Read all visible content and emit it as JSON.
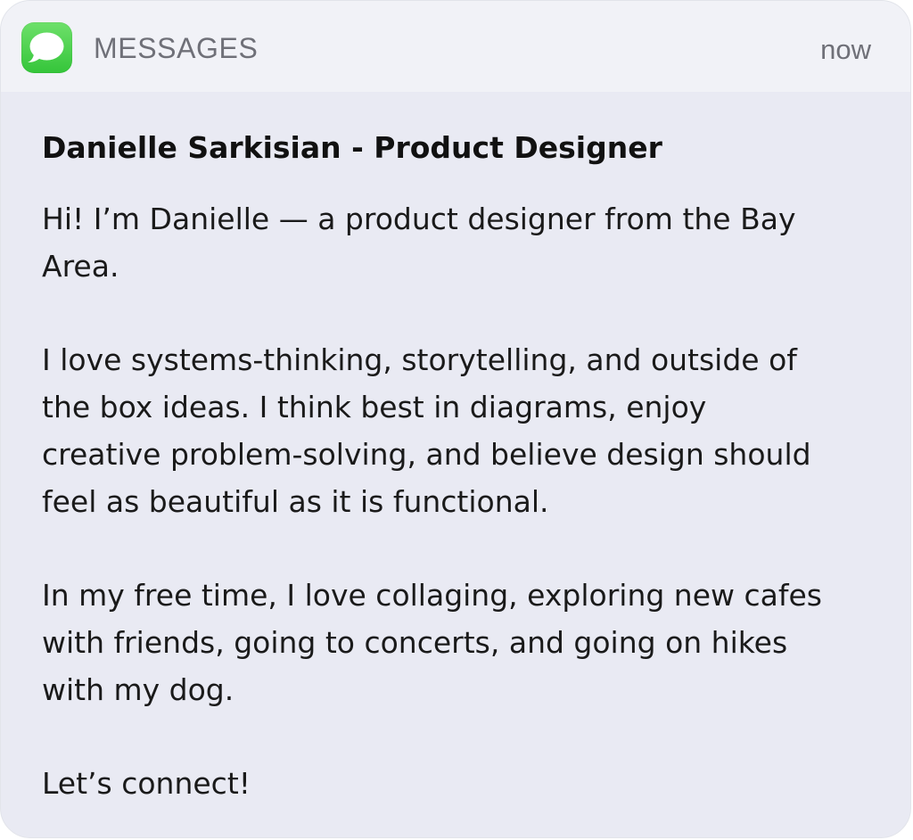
{
  "notification": {
    "app": {
      "name": "MESSAGES",
      "icon": "messages-bubble-icon",
      "icon_color": "#4cd15a"
    },
    "timestamp": "now",
    "sender": "Danielle Sarkisian - Product Designer",
    "body": {
      "paragraphs": [
        "Hi! I’m Danielle — a product designer from the Bay\nArea.",
        "I love systems-thinking, storytelling, and outside of\nthe box ideas. I think best in diagrams, enjoy\ncreative problem-solving, and believe design should\nfeel as beautiful as it is functional.",
        "In my free time, I love collaging, exploring new cafes\nwith friends, going to concerts, and going on hikes\nwith my dog.",
        "Let’s connect!"
      ]
    }
  }
}
